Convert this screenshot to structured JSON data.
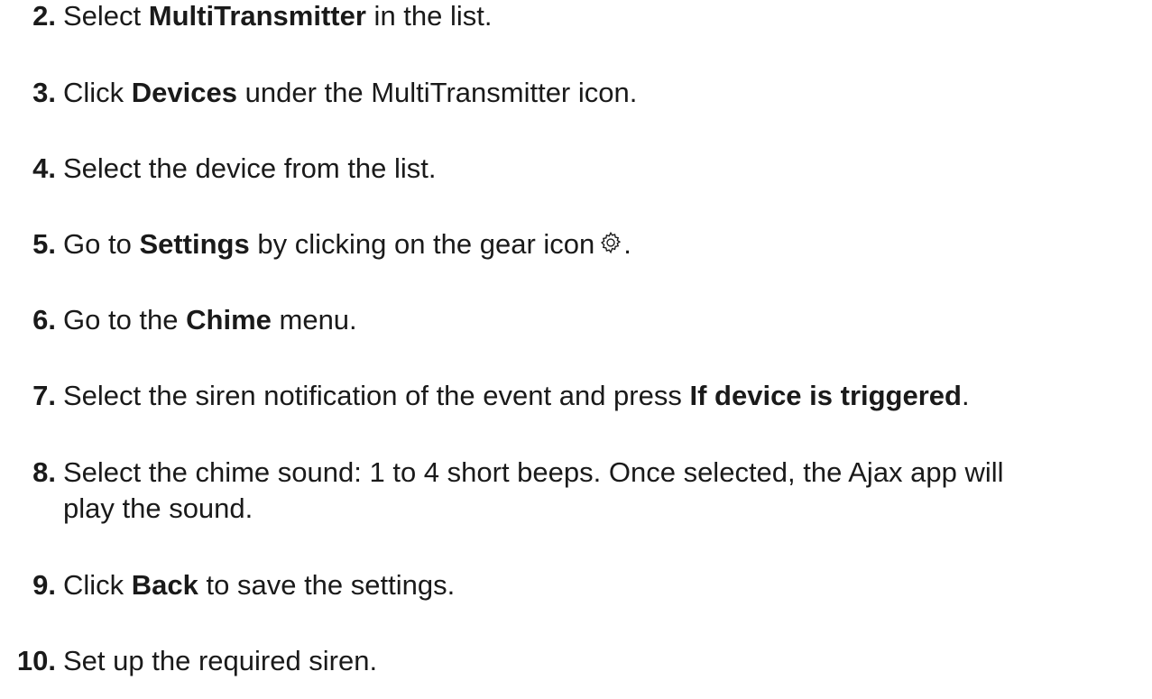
{
  "steps": [
    {
      "num": "2.",
      "pre": "Select ",
      "bold": "MultiTransmitter",
      "post": " in the list."
    },
    {
      "num": "3.",
      "pre": "Click ",
      "bold": "Devices",
      "post": " under the MultiTransmitter icon."
    },
    {
      "num": "4.",
      "pre": "Select the device from the list.",
      "bold": "",
      "post": ""
    },
    {
      "num": "5.",
      "pre": "Go to ",
      "bold": "Settings",
      "post": " by clicking on the gear icon",
      "icon": "gear-icon",
      "tail": "."
    },
    {
      "num": "6.",
      "pre": "Go to the ",
      "bold": "Chime",
      "post": " menu."
    },
    {
      "num": "7.",
      "pre": "Select the siren notification of the event and press ",
      "bold": "If device is triggered",
      "post": "."
    },
    {
      "num": "8.",
      "pre": "Select the chime sound: 1 to 4 short beeps. Once selected, the Ajax app will",
      "bold": "",
      "post": "",
      "line2": "play the sound."
    },
    {
      "num": "9.",
      "pre": "Click ",
      "bold": "Back",
      "post": " to save the settings."
    },
    {
      "num": "10.",
      "pre": "Set up the required siren.",
      "bold": "",
      "post": ""
    }
  ]
}
